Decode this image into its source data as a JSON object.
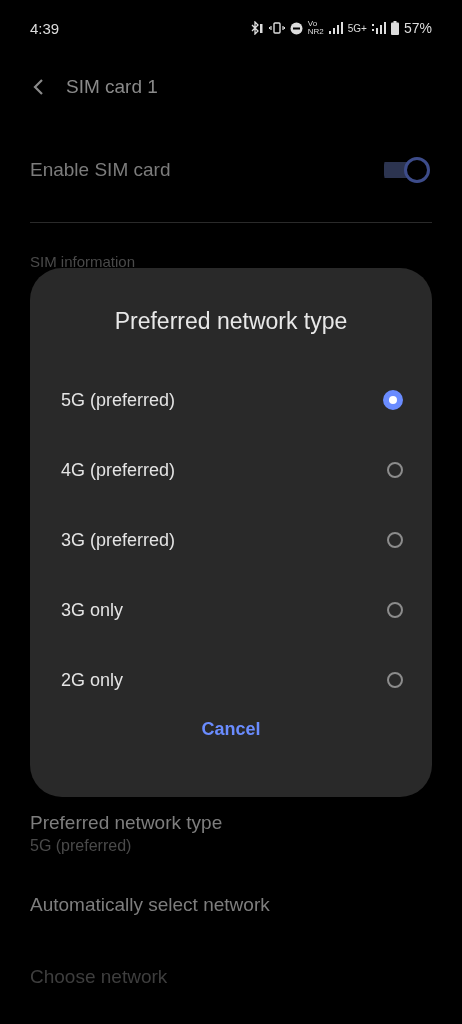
{
  "status_bar": {
    "time": "4:39",
    "volte": [
      "Vo",
      "NR2"
    ],
    "network": "5G+",
    "battery": "57%"
  },
  "header": {
    "title": "SIM card 1"
  },
  "enable_sim": {
    "label": "Enable SIM card",
    "on": true
  },
  "section": "SIM information",
  "dialog": {
    "title": "Preferred network type",
    "options": [
      {
        "label": "5G (preferred)",
        "selected": true
      },
      {
        "label": "4G (preferred)",
        "selected": false
      },
      {
        "label": "3G (preferred)",
        "selected": false
      },
      {
        "label": "3G only",
        "selected": false
      },
      {
        "label": "2G only",
        "selected": false
      }
    ],
    "cancel": "Cancel"
  },
  "settings": [
    {
      "title": "Preferred network type",
      "summary": "5G (preferred)",
      "disabled": false
    },
    {
      "title": "Automatically select network",
      "disabled": false
    },
    {
      "title": "Choose network",
      "disabled": true
    }
  ]
}
